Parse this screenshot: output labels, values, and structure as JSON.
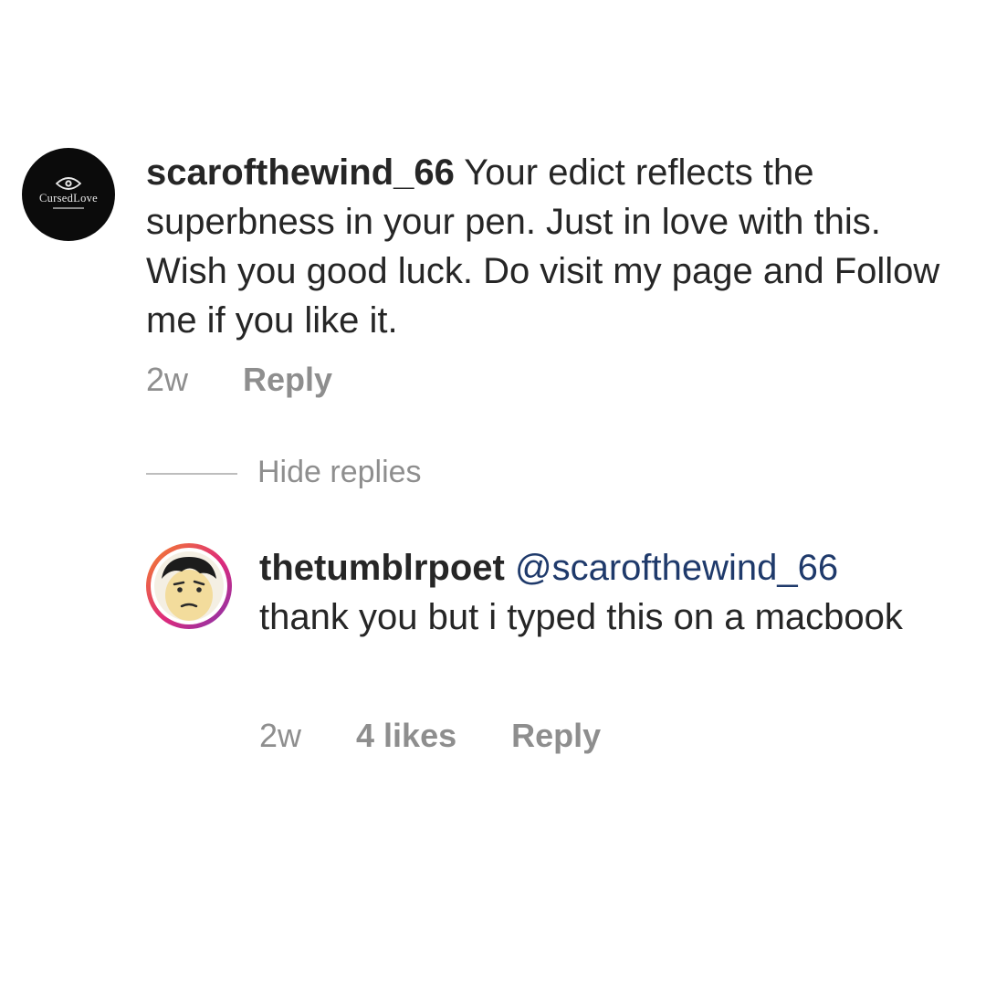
{
  "comment": {
    "username": "scarofthewind_66",
    "text": " Your edict reflects the superbness in your pen. Just in love with this. Wish you good luck. Do visit my page and Follow me if you like it.",
    "time": "2w",
    "reply_label": "Reply",
    "avatar": {
      "icon": "eye-logo-icon",
      "logo_text": "CursedLove",
      "background": "#0b0b0b"
    }
  },
  "hide_replies": {
    "label": "Hide replies"
  },
  "reply": {
    "username": "thetumblrpoet",
    "mention": "@scarofthewind_66",
    "text": "thank you but i typed this on a macbook",
    "time": "2w",
    "likes": "4 likes",
    "reply_label": "Reply",
    "avatar": {
      "icon": "confused-face-icon",
      "ring_colors": [
        "#f58529",
        "#dd2a7b",
        "#8134af"
      ]
    }
  },
  "colors": {
    "text": "#262626",
    "meta": "#8e8e8e",
    "mention": "#1f3a6b"
  }
}
